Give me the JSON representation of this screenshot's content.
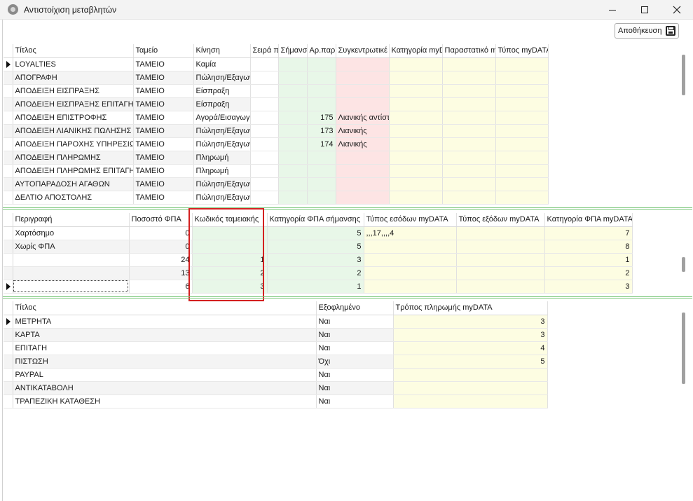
{
  "window": {
    "title": "Αντιστοίχιση μεταβλητών"
  },
  "toolbar": {
    "save_label": "Αποθήκευση"
  },
  "grid1": {
    "headers": [
      "Τίτλος",
      "Ταμείο",
      "Κίνηση",
      "Σειρά π",
      "Σήμανσ",
      "Αρ.παρ",
      "Συγκεντρωτικέ",
      "Κατηγορία myD",
      "Παραστατικό m",
      "Τύπος myDATA"
    ],
    "rows": [
      [
        "LOYALTIES",
        "ΤΑΜΕΙΟ",
        "Καμία",
        "",
        "",
        "",
        "",
        "",
        "",
        ""
      ],
      [
        "ΑΠΟΓΡΑΦΗ",
        "ΤΑΜΕΙΟ",
        "Πώληση/Εξαγωγ",
        "",
        "",
        "",
        "",
        "",
        "",
        ""
      ],
      [
        "ΑΠΟΔΕΙΞΗ ΕΙΣΠΡΑΞΗΣ",
        "ΤΑΜΕΙΟ",
        "Είσπραξη",
        "",
        "",
        "",
        "",
        "",
        "",
        ""
      ],
      [
        "ΑΠΟΔΕΙΞΗ ΕΙΣΠΡΑΞΗΣ ΕΠΙΤΑΓΗ",
        "ΤΑΜΕΙΟ",
        "Είσπραξη",
        "",
        "",
        "",
        "",
        "",
        "",
        ""
      ],
      [
        "ΑΠΟΔΕΙΞΗ ΕΠΙΣΤΡΟΦΗΣ",
        "ΤΑΜΕΙΟ",
        "Αγορά/Εισαγωγ",
        "",
        "",
        "175",
        "Λιανικής αντίστ",
        "",
        "",
        ""
      ],
      [
        "ΑΠΟΔΕΙΞΗ ΛΙΑΝΙΚΗΣ ΠΩΛΗΣΗΣ",
        "ΤΑΜΕΙΟ",
        "Πώληση/Εξαγωγ",
        "",
        "",
        "173",
        "Λιανικής",
        "",
        "",
        ""
      ],
      [
        "ΑΠΟΔΕΙΞΗ ΠΑΡΟΧΗΣ ΥΠΗΡΕΣΙΩΝ",
        "ΤΑΜΕΙΟ",
        "Πώληση/Εξαγωγ",
        "",
        "",
        "174",
        "Λιανικής",
        "",
        "",
        ""
      ],
      [
        "ΑΠΟΔΕΙΞΗ ΠΛΗΡΩΜΗΣ",
        "ΤΑΜΕΙΟ",
        "Πληρωμή",
        "",
        "",
        "",
        "",
        "",
        "",
        ""
      ],
      [
        "ΑΠΟΔΕΙΞΗ ΠΛΗΡΩΜΗΣ ΕΠΙΤΑΓΗ",
        "ΤΑΜΕΙΟ",
        "Πληρωμή",
        "",
        "",
        "",
        "",
        "",
        "",
        ""
      ],
      [
        "ΑΥΤΟΠΑΡΑΔΟΣΗ ΑΓΑΘΩΝ",
        "ΤΑΜΕΙΟ",
        "Πώληση/Εξαγωγ",
        "",
        "",
        "",
        "",
        "",
        "",
        ""
      ],
      [
        "ΔΕΛΤΙΟ ΑΠΟΣΤΟΛΗΣ",
        "ΤΑΜΕΙΟ",
        "Πώληση/Εξαγωγ",
        "",
        "",
        "",
        "",
        "",
        "",
        ""
      ]
    ]
  },
  "grid2": {
    "headers": [
      "Περιγραφή",
      "Ποσοστό ΦΠΑ",
      "Κωδικός ταμειακής",
      "Κατηγορία ΦΠΑ σήμανσης",
      "Τύπος εσόδων myDATA",
      "Τύπος εξόδων myDATA",
      "Κατηγορία ΦΠΑ myDATA"
    ],
    "rows": [
      [
        "Χαρτόσημο",
        "0",
        "",
        "5",
        ",,,17,,,,4",
        "",
        "7"
      ],
      [
        "Χωρίς ΦΠΑ",
        "0",
        "",
        "5",
        "",
        "",
        "8"
      ],
      [
        "",
        "24",
        "1",
        "3",
        "",
        "",
        "1"
      ],
      [
        "",
        "13",
        "2",
        "2",
        "",
        "",
        "2"
      ],
      [
        "",
        "6",
        "3",
        "1",
        "",
        "",
        "3"
      ]
    ]
  },
  "grid3": {
    "headers": [
      "Τίτλος",
      "Εξοφλημένο",
      "Τρόπος πληρωμής myDATA"
    ],
    "rows": [
      [
        "ΜΕΤΡΗΤΑ",
        "Ναι",
        "3"
      ],
      [
        "ΚΑΡΤΑ",
        "Ναι",
        "3"
      ],
      [
        "ΕΠΙΤΑΓΗ",
        "Ναι",
        "4"
      ],
      [
        "ΠΙΣΤΩΣΗ",
        "Όχι",
        "5"
      ],
      [
        "PAYPAL",
        "Ναι",
        ""
      ],
      [
        "ΑΝΤΙΚΑΤΑΒΟΛΗ",
        "Ναι",
        ""
      ],
      [
        "ΤΡΑΠΕΖΙΚΗ ΚΑΤΑΘΕΣΗ",
        "Ναι",
        ""
      ]
    ]
  },
  "icons": {
    "app": "app-gear-icon",
    "save": "floppy-disk-icon",
    "row_indicator": "row-pointer-icon"
  }
}
